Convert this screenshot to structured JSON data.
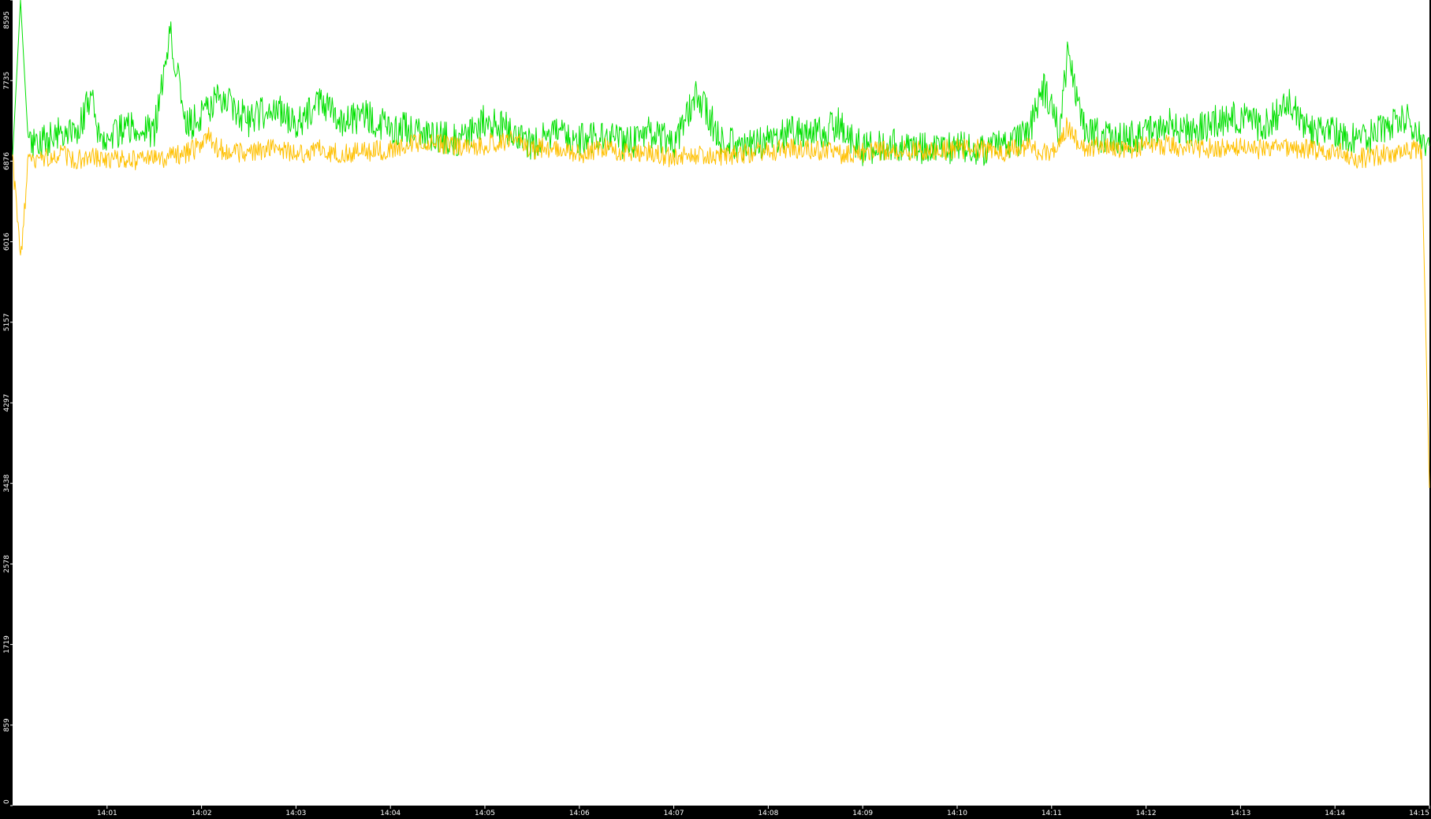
{
  "chart_data": {
    "type": "line",
    "title": "",
    "xlabel": "",
    "ylabel": "",
    "colors": {
      "background": "#ffffff",
      "frame": "#000000",
      "tick_text": "#ffffff",
      "series": [
        "#00e000",
        "#ffc000"
      ]
    },
    "grid": false,
    "legend": "none",
    "ylim": [
      0,
      8595
    ],
    "yticks": [
      {
        "value": 0,
        "label": "0"
      },
      {
        "value": 859,
        "label": "859"
      },
      {
        "value": 1719,
        "label": "1719"
      },
      {
        "value": 2578,
        "label": "2578"
      },
      {
        "value": 3438,
        "label": "3438"
      },
      {
        "value": 4297,
        "label": "4297"
      },
      {
        "value": 5157,
        "label": "5157"
      },
      {
        "value": 6016,
        "label": "6016"
      },
      {
        "value": 6876,
        "label": "6876"
      },
      {
        "value": 7735,
        "label": "7735"
      },
      {
        "value": 8595,
        "label": "8595"
      }
    ],
    "xlim": [
      "14:00",
      "14:15"
    ],
    "xticks": [
      {
        "value": "14:01",
        "label": "14:01"
      },
      {
        "value": "14:02",
        "label": "14:02"
      },
      {
        "value": "14:03",
        "label": "14:03"
      },
      {
        "value": "14:04",
        "label": "14:04"
      },
      {
        "value": "14:05",
        "label": "14:05"
      },
      {
        "value": "14:06",
        "label": "14:06"
      },
      {
        "value": "14:07",
        "label": "14:07"
      },
      {
        "value": "14:08",
        "label": "14:08"
      },
      {
        "value": "14:09",
        "label": "14:09"
      },
      {
        "value": "14:10",
        "label": "14:10"
      },
      {
        "value": "14:11",
        "label": "14:11"
      },
      {
        "value": "14:12",
        "label": "14:12"
      },
      {
        "value": "14:13",
        "label": "14:13"
      },
      {
        "value": "14:14",
        "label": "14:14"
      },
      {
        "value": "14:15",
        "label": "14:15"
      }
    ],
    "series": [
      {
        "x": [
          "14:00:00",
          "14:00:05",
          "14:00:10",
          "14:00:20",
          "14:00:30",
          "14:00:40",
          "14:00:50",
          "14:00:55",
          "14:01:00",
          "14:01:10",
          "14:01:20",
          "14:01:30",
          "14:01:40",
          "14:01:50",
          "14:02:00",
          "14:02:05",
          "14:02:10",
          "14:02:20",
          "14:02:30",
          "14:02:40",
          "14:02:50",
          "14:03:00",
          "14:03:15",
          "14:03:30",
          "14:03:45",
          "14:04:00",
          "14:04:15",
          "14:04:30",
          "14:04:45",
          "14:05:00",
          "14:05:15",
          "14:05:30",
          "14:05:45",
          "14:06:00",
          "14:06:15",
          "14:06:30",
          "14:06:45",
          "14:07:00",
          "14:07:15",
          "14:07:30",
          "14:07:45",
          "14:08:00",
          "14:08:15",
          "14:08:30",
          "14:08:45",
          "14:09:00",
          "14:09:15",
          "14:09:30",
          "14:09:45",
          "14:10:00",
          "14:10:15",
          "14:10:30",
          "14:10:45",
          "14:10:55",
          "14:11:05",
          "14:11:10",
          "14:11:20",
          "14:11:30",
          "14:11:45",
          "14:12:00",
          "14:12:15",
          "14:12:30",
          "14:12:45",
          "14:13:00",
          "14:13:15",
          "14:13:30",
          "14:13:45",
          "14:14:00",
          "14:14:15",
          "14:14:30",
          "14:14:45",
          "14:14:55",
          "14:15:00"
        ],
        "values": [
          6930,
          8595,
          7050,
          7080,
          7210,
          7120,
          7610,
          7150,
          7110,
          7220,
          7230,
          7190,
          8280,
          7240,
          7360,
          7420,
          7550,
          7450,
          7300,
          7400,
          7420,
          7240,
          7500,
          7300,
          7350,
          7240,
          7200,
          7130,
          7100,
          7320,
          7210,
          7050,
          7190,
          7100,
          7170,
          7050,
          7200,
          7050,
          7600,
          7100,
          7050,
          7080,
          7190,
          7150,
          7280,
          7000,
          7050,
          7040,
          7000,
          7030,
          7000,
          7050,
          7150,
          7650,
          7210,
          8000,
          7260,
          7150,
          7100,
          7180,
          7280,
          7190,
          7300,
          7350,
          7230,
          7500,
          7200,
          7190,
          7080,
          7200,
          7350,
          7150,
          7040
        ]
      },
      {
        "x": [
          "14:00:00",
          "14:00:05",
          "14:00:10",
          "14:00:20",
          "14:00:30",
          "14:00:40",
          "14:00:50",
          "14:00:55",
          "14:01:00",
          "14:01:10",
          "14:01:20",
          "14:01:30",
          "14:01:40",
          "14:01:50",
          "14:02:00",
          "14:02:05",
          "14:02:10",
          "14:02:20",
          "14:02:30",
          "14:02:40",
          "14:02:50",
          "14:03:00",
          "14:03:15",
          "14:03:30",
          "14:03:45",
          "14:04:00",
          "14:04:15",
          "14:04:30",
          "14:04:45",
          "14:05:00",
          "14:05:15",
          "14:05:30",
          "14:05:45",
          "14:06:00",
          "14:06:15",
          "14:06:30",
          "14:06:45",
          "14:07:00",
          "14:07:15",
          "14:07:30",
          "14:07:45",
          "14:08:00",
          "14:08:15",
          "14:08:30",
          "14:08:45",
          "14:09:00",
          "14:09:15",
          "14:09:30",
          "14:09:45",
          "14:10:00",
          "14:10:15",
          "14:10:30",
          "14:10:45",
          "14:10:55",
          "14:11:05",
          "14:11:10",
          "14:11:20",
          "14:11:30",
          "14:11:45",
          "14:12:00",
          "14:12:15",
          "14:12:30",
          "14:12:45",
          "14:13:00",
          "14:13:15",
          "14:13:30",
          "14:13:45",
          "14:14:00",
          "14:14:15",
          "14:14:30",
          "14:14:45",
          "14:14:55",
          "14:15:00"
        ],
        "values": [
          6880,
          5800,
          6900,
          6900,
          6950,
          6880,
          6930,
          6900,
          6880,
          6900,
          6890,
          6900,
          6920,
          6950,
          7050,
          7150,
          7020,
          6950,
          6990,
          7000,
          7010,
          6930,
          7000,
          6950,
          6980,
          7000,
          7080,
          7060,
          7020,
          7050,
          7100,
          7000,
          7030,
          6950,
          7020,
          6960,
          6980,
          6900,
          6950,
          6930,
          6960,
          6980,
          7010,
          7000,
          6950,
          6960,
          7000,
          6990,
          6990,
          7010,
          7000,
          6980,
          7020,
          6950,
          7050,
          7250,
          7010,
          7030,
          7000,
          7030,
          7050,
          7000,
          7020,
          7030,
          7000,
          7010,
          7000,
          6980,
          6900,
          6950,
          7000,
          7000,
          3390
        ]
      }
    ]
  }
}
